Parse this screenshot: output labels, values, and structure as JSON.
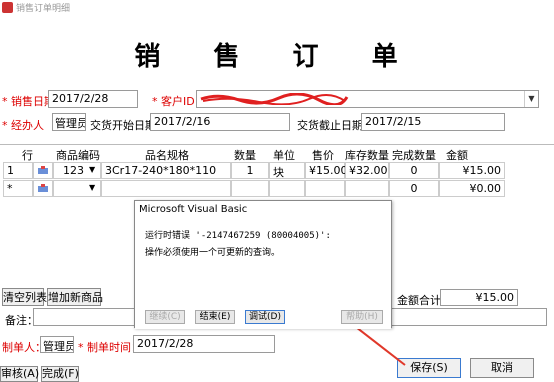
{
  "window": {
    "title": "销售订单明细"
  },
  "header": {
    "title": "销 售 订 单"
  },
  "form": {
    "sale_date_label": "* 销售日期：",
    "sale_date": "2017/2/28",
    "customer_label": "* 客户ID：",
    "agent_label": "* 经办人",
    "agent_value": "管理员",
    "delivery_start_label": "交货开始日期：",
    "delivery_start": "2017/2/16",
    "delivery_end_label": "交货截止日期：",
    "delivery_end": "2017/2/15"
  },
  "grid": {
    "headers": [
      "行",
      "商品编码",
      "品名规格",
      "数量",
      "单位",
      "售价",
      "库存数量",
      "完成数量",
      "金额"
    ],
    "rows": [
      {
        "row": "1",
        "code": "123",
        "name": "3Cr17-240*180*110",
        "qty": "1",
        "unit": "块",
        "price": "¥15.00",
        "stock": "¥32.00",
        "done": "0",
        "amount": "¥15.00"
      },
      {
        "row": "*",
        "code": "",
        "name": "",
        "qty": "",
        "unit": "",
        "price": "",
        "stock": "",
        "done": "0",
        "amount": "¥0.00"
      }
    ]
  },
  "actions": {
    "clear_list": "清空列表",
    "add_product": "增加新商品"
  },
  "total": {
    "label": "金额合计:",
    "value": "¥15.00"
  },
  "remarks": {
    "label": "备注："
  },
  "footer": {
    "maker_label": "制单人：",
    "maker_value": "管理员",
    "make_time_label": "* 制单时间：",
    "make_time": "2017/2/28",
    "save": "保存(S)",
    "cancel": "取消",
    "audit": "审核(A)",
    "complete": "完成(F)"
  },
  "dialog": {
    "title": "Microsoft Visual Basic",
    "line1": "运行时错误 '-2147467259 (80004005)':",
    "line2": "操作必须使用一个可更新的查询。",
    "btn_continue": "继续(C)",
    "btn_end": "结束(E)",
    "btn_debug": "调试(D)",
    "btn_help": "帮助(H)"
  },
  "colors": {
    "required": "#dd0000",
    "arrow": "#e0382a",
    "redaction": "#e02020"
  }
}
